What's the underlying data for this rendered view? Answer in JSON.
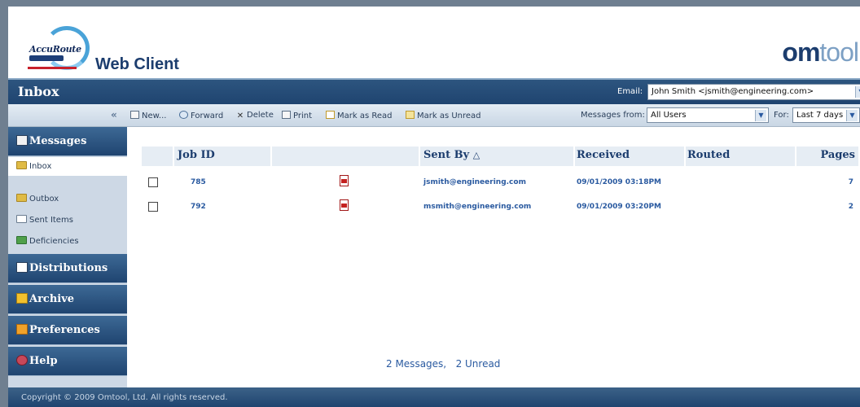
{
  "header": {
    "logo_text": "AccuRoute",
    "app_title": "Web Client",
    "brand_a": "om",
    "brand_b": "tool"
  },
  "titlebar": {
    "title": "Inbox",
    "email_label": "Email:",
    "email_value": "John Smith <jsmith@engineering.com>"
  },
  "toolbar": {
    "collapse": "«",
    "new": "New...",
    "forward": "Forward",
    "delete": "Delete",
    "print": "Print",
    "mark_read": "Mark as Read",
    "mark_unread": "Mark as Unread",
    "messages_from_label": "Messages from:",
    "messages_from_value": "All Users",
    "for_label": "For:",
    "for_value": "Last 7 days"
  },
  "sidebar": {
    "messages": "Messages",
    "inbox": "Inbox",
    "outbox": "Outbox",
    "sent_items": "Sent Items",
    "deficiencies": "Deficiencies",
    "distributions": "Distributions",
    "archive": "Archive",
    "preferences": "Preferences",
    "help": "Help"
  },
  "table": {
    "headers": {
      "job_id": "Job ID",
      "sent_by": "Sent By",
      "sort_icon": "△",
      "received": "Received",
      "routed": "Routed",
      "pages": "Pages"
    },
    "rows": [
      {
        "job_id": "785",
        "sent_by": "jsmith@engineering.com",
        "received": "09/01/2009 03:18PM",
        "routed": "",
        "pages": "7"
      },
      {
        "job_id": "792",
        "sent_by": "msmith@engineering.com",
        "received": "09/01/2009 03:20PM",
        "routed": "",
        "pages": "2"
      }
    ]
  },
  "summary": {
    "messages": "2 Messages,",
    "unread": "2 Unread"
  },
  "footer": {
    "copyright": "Copyright © 2009 Omtool, Ltd. All rights reserved."
  },
  "colors": {
    "navy": "#1f4470",
    "link_blue": "#2a5aa0",
    "brand_light": "#7da0c4"
  }
}
